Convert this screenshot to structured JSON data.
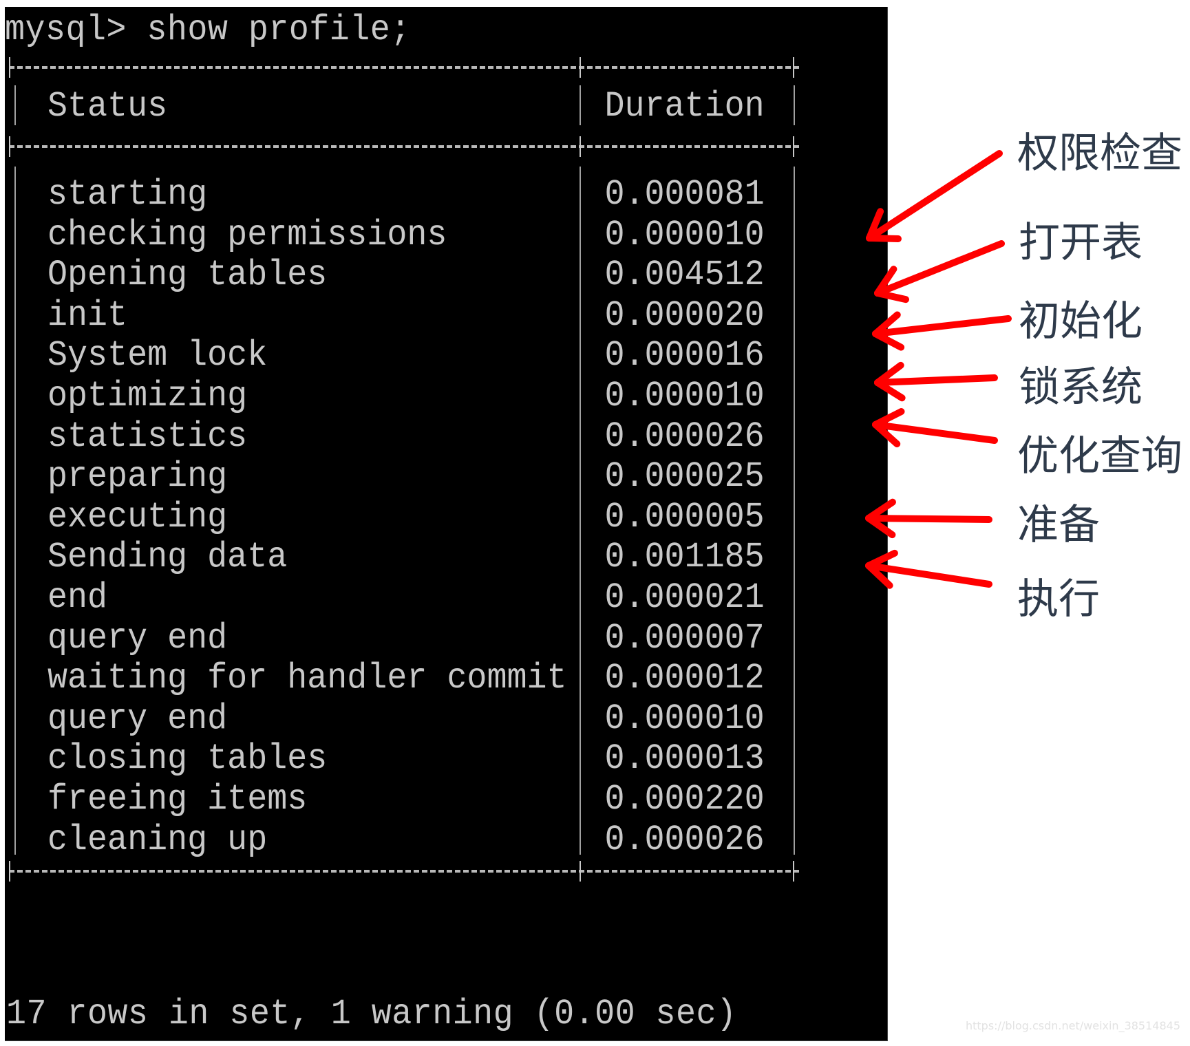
{
  "terminal": {
    "prompt": "mysql> show profile;",
    "columns": [
      "Status",
      "Duration"
    ],
    "rows": [
      {
        "status": "starting",
        "duration": "0.000081"
      },
      {
        "status": "checking permissions",
        "duration": "0.000010"
      },
      {
        "status": "Opening tables",
        "duration": "0.004512"
      },
      {
        "status": "init",
        "duration": "0.000020"
      },
      {
        "status": "System lock",
        "duration": "0.000016"
      },
      {
        "status": "optimizing",
        "duration": "0.000010"
      },
      {
        "status": "statistics",
        "duration": "0.000026"
      },
      {
        "status": "preparing",
        "duration": "0.000025"
      },
      {
        "status": "executing",
        "duration": "0.000005"
      },
      {
        "status": "Sending data",
        "duration": "0.001185"
      },
      {
        "status": "end",
        "duration": "0.000021"
      },
      {
        "status": "query end",
        "duration": "0.000007"
      },
      {
        "status": "waiting for handler commit",
        "duration": "0.000012"
      },
      {
        "status": "query end",
        "duration": "0.000010"
      },
      {
        "status": "closing tables",
        "duration": "0.000013"
      },
      {
        "status": "freeing items",
        "duration": "0.000220"
      },
      {
        "status": "cleaning up",
        "duration": "0.000026"
      }
    ],
    "footer": "17 rows in set, 1 warning (0.00 sec)"
  },
  "annotations": [
    {
      "label": "权限检查",
      "target_row": "checking permissions"
    },
    {
      "label": "打开表",
      "target_row": "Opening tables"
    },
    {
      "label": "初始化",
      "target_row": "init"
    },
    {
      "label": "锁系统",
      "target_row": "System lock"
    },
    {
      "label": "优化查询",
      "target_row": "optimizing"
    },
    {
      "label": "准备",
      "target_row": "preparing"
    },
    {
      "label": "执行",
      "target_row": "executing"
    }
  ],
  "colors": {
    "terminal_bg": "#000000",
    "terminal_text": "#c8c8c8",
    "arrow": "#ff0000",
    "annotation_text": "#2e3a4a"
  },
  "watermark": "https://blog.csdn.net/weixin_38514845"
}
